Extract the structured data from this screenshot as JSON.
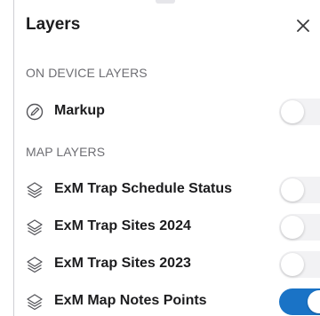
{
  "panel": {
    "title": "Layers",
    "close_icon": "close-x-icon"
  },
  "sections": {
    "on_device": "ON DEVICE LAYERS",
    "map": "MAP LAYERS"
  },
  "on_device_layers": [
    {
      "label": "Markup",
      "icon": "markup-pencil-circle-icon",
      "enabled": false
    }
  ],
  "map_layers": [
    {
      "label": "ExM Trap Schedule Status",
      "icon": "layers-stack-icon",
      "enabled": false
    },
    {
      "label": "ExM Trap Sites 2024",
      "icon": "layers-stack-icon",
      "enabled": false
    },
    {
      "label": "ExM Trap Sites 2023",
      "icon": "layers-stack-icon",
      "enabled": false
    },
    {
      "label": "ExM Map Notes Points",
      "icon": "layers-stack-icon",
      "enabled": true
    }
  ],
  "colors": {
    "toggle_on": "#1a73c6",
    "toggle_off": "#f2f2f4",
    "section_text": "#6e6e73"
  }
}
